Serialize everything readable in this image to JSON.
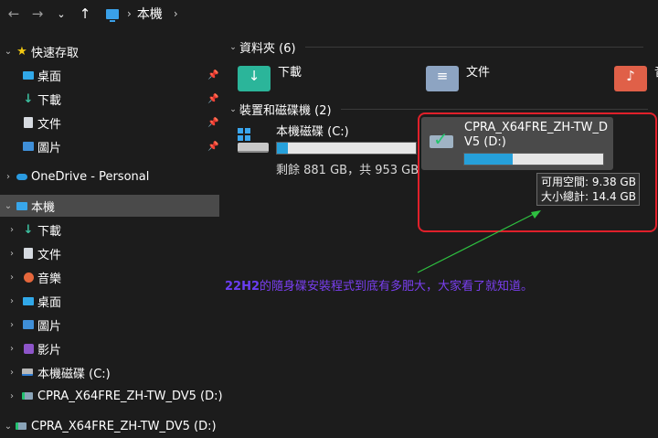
{
  "toolbar": {
    "back_icon": "arrow-left",
    "forward_icon": "arrow-right",
    "recent_icon": "chevron-down",
    "up_icon": "arrow-up",
    "breadcrumb": [
      "本機"
    ]
  },
  "sidebar": {
    "quick_access": {
      "label": "快速存取",
      "items": [
        {
          "label": "桌面",
          "icon": "desktop"
        },
        {
          "label": "下載",
          "icon": "download"
        },
        {
          "label": "文件",
          "icon": "document"
        },
        {
          "label": "圖片",
          "icon": "pictures"
        }
      ]
    },
    "onedrive": {
      "label": "OneDrive - Personal"
    },
    "this_pc": {
      "label": "本機",
      "items": [
        {
          "label": "下載",
          "icon": "download"
        },
        {
          "label": "文件",
          "icon": "document"
        },
        {
          "label": "音樂",
          "icon": "music"
        },
        {
          "label": "桌面",
          "icon": "desktop"
        },
        {
          "label": "圖片",
          "icon": "pictures"
        },
        {
          "label": "影片",
          "icon": "videos"
        },
        {
          "label": "本機磁碟 (C:)",
          "icon": "drive"
        },
        {
          "label": "CPRA_X64FRE_ZH-TW_DV5 (D:)",
          "icon": "usb-drive"
        }
      ]
    },
    "usb_root": {
      "label": "CPRA_X64FRE_ZH-TW_DV5 (D:)"
    }
  },
  "main": {
    "folders_header": "資料夾 (6)",
    "folders": [
      {
        "label": "下載"
      },
      {
        "label": "文件"
      },
      {
        "label": "音"
      }
    ],
    "drives_header": "裝置和磁碟機 (2)",
    "drive_c": {
      "name": "本機磁碟 (C:)",
      "free_text": "剩餘 881 GB，共 953 GB",
      "used_fraction": 0.076
    },
    "drive_d": {
      "name_line1": "CPRA_X64FRE_ZH-TW_D",
      "name_line2": "V5 (D:)",
      "used_fraction": 0.35
    },
    "tooltip": {
      "line1": "可用空間: 9.38 GB",
      "line2": "大小總計: 14.4 GB"
    }
  },
  "annotation": {
    "bold": "22H2",
    "text": "的隨身碟安裝程式到底有多肥大，大家看了就知道。"
  },
  "colors": {
    "accent": "#26a0da",
    "highlight": "#e0202a",
    "annotation": "#7a3ff0",
    "arrow": "#2ec040"
  }
}
